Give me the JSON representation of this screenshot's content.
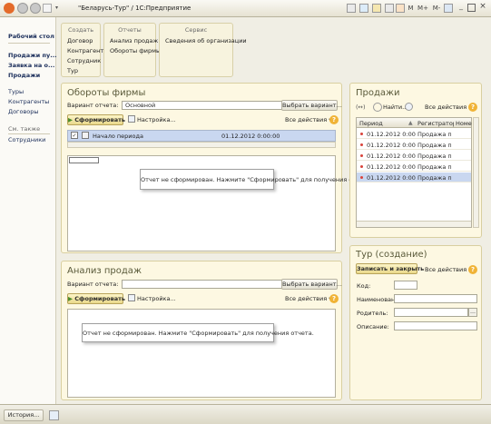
{
  "window": {
    "title": "\"Беларусь-Тур\" / 1С:Предприятие",
    "buttons": [
      "M",
      "M+",
      "M-"
    ]
  },
  "left_panel": {
    "desktop_label": "Рабочий стол",
    "sections": [
      "Продажи пу...",
      "Заявка на о...",
      "Продажи"
    ],
    "links": [
      "Туры",
      "Контрагенты",
      "Договоры"
    ],
    "see_also_label": "См. также",
    "see_also_links": [
      "Сотрудники"
    ]
  },
  "command_groups": [
    {
      "title": "Создать",
      "items": [
        "Договор",
        "Контрагент",
        "Сотрудник",
        "Тур"
      ]
    },
    {
      "title": "Отчеты",
      "items": [
        "Анализ продаж",
        "Обороты фирмы"
      ]
    },
    {
      "title": "Сервис",
      "items": [
        "Сведения об организации"
      ]
    }
  ],
  "turnover_report": {
    "title": "Обороты фирмы",
    "variant_label": "Вариант отчета:",
    "variant_value": "Основной",
    "choose_variant": "Выбрать вариант...",
    "generate": "Сформировать",
    "settings": "Настройка...",
    "all_actions": "Все действия ▾",
    "period_label": "Начало периода",
    "period_value": "01.12.2012 0:00:00",
    "not_generated_msg": "Отчет не сформирован. Нажмите \"Сформировать\" для получения отчета."
  },
  "sales_analysis": {
    "title": "Анализ продаж",
    "variant_label": "Вариант отчета:",
    "variant_value": "",
    "choose_variant": "Выбрать вариант...",
    "generate": "Сформировать",
    "settings": "Настройка...",
    "all_actions": "Все действия ▾",
    "not_generated_msg": "Отчет не сформирован. Нажмите \"Сформировать\" для получения отчета."
  },
  "sales": {
    "title": "Продажи",
    "find": "Найти...",
    "all_actions": "Все действия ▾",
    "columns": [
      "Период",
      "Регистратор",
      "Номе"
    ],
    "rows": [
      {
        "period": "01.12.2012 0:00:00",
        "registrar": "Продажа п",
        "selected": false
      },
      {
        "period": "01.12.2012 0:00:00",
        "registrar": "Продажа п",
        "selected": false
      },
      {
        "period": "01.12.2012 0:00:00",
        "registrar": "Продажа п",
        "selected": false
      },
      {
        "period": "01.12.2012 0:00:00",
        "registrar": "Продажа п",
        "selected": false
      },
      {
        "period": "01.12.2012 0:00:00",
        "registrar": "Продажа п",
        "selected": true
      }
    ]
  },
  "tour_form": {
    "title": "Тур (создание)",
    "save_close": "Записать и закрыть",
    "all_actions": "Все действия ▾",
    "code_label": "Код:",
    "name_label": "Наименование:",
    "parent_label": "Родитель:",
    "desc_label": "Описание:"
  },
  "bottom": {
    "history": "История..."
  },
  "colors": {
    "panel_bg": "#fdf8e2",
    "panel_border": "#d9cfa0",
    "selection": "#c9d7f0",
    "help": "#f0b336",
    "marker": "#d9433b"
  }
}
